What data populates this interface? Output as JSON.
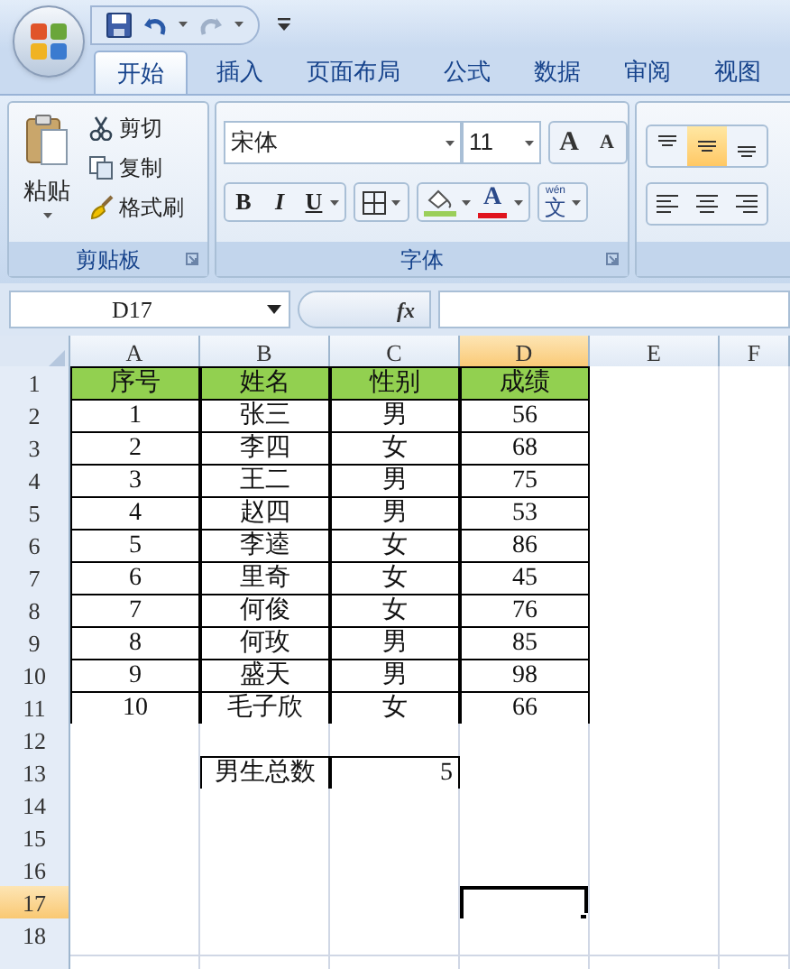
{
  "quick_access_toolbar": {
    "redo_disabled": true
  },
  "tabs": [
    {
      "label": "开始",
      "selected": true
    },
    {
      "label": "插入",
      "selected": false
    },
    {
      "label": "页面布局",
      "selected": false
    },
    {
      "label": "公式",
      "selected": false
    },
    {
      "label": "数据",
      "selected": false
    },
    {
      "label": "审阅",
      "selected": false
    },
    {
      "label": "视图",
      "selected": false
    }
  ],
  "ribbon": {
    "clipboard": {
      "paste": "粘贴",
      "cut": "剪切",
      "copy": "复制",
      "format_painter": "格式刷",
      "label": "剪贴板"
    },
    "font": {
      "font_name": "宋体",
      "font_size": "11",
      "grow_font": "A",
      "shrink_font": "A",
      "bold": "B",
      "italic": "I",
      "underline": "U",
      "font_color": "A",
      "phonetic_pinyin": "wén",
      "phonetic_char": "文",
      "label": "字体"
    },
    "alignment": {
      "vertical_align": [
        {
          "selected": false
        },
        {
          "selected": true
        },
        {
          "selected": false
        }
      ],
      "horizontal_align": [
        {
          "selected": false
        },
        {
          "selected": false
        },
        {
          "selected": false
        }
      ]
    }
  },
  "formula_bar": {
    "name_box": "D17",
    "function_button": "fx"
  },
  "columns": [
    {
      "label": "A",
      "selected": false
    },
    {
      "label": "B",
      "selected": false
    },
    {
      "label": "C",
      "selected": false
    },
    {
      "label": "D",
      "selected": true
    },
    {
      "label": "E",
      "selected": false
    },
    {
      "label": "F",
      "selected": false
    }
  ],
  "rows": [
    {
      "header": "1",
      "selected": false,
      "kind": "header",
      "cells": [
        {
          "text": "序号",
          "bordered": true,
          "selected": false
        },
        {
          "text": "姓名",
          "bordered": true,
          "selected": false
        },
        {
          "text": "性别",
          "bordered": true,
          "selected": false
        },
        {
          "text": "成绩",
          "bordered": true,
          "selected": false
        },
        {
          "bordered": false,
          "selected": false
        },
        {
          "bordered": false,
          "selected": false
        }
      ]
    },
    {
      "header": "2",
      "selected": false,
      "kind": "data",
      "cells": [
        {
          "text": "1",
          "bordered": true,
          "selected": false
        },
        {
          "text": "张三",
          "bordered": true,
          "selected": false
        },
        {
          "text": "男",
          "bordered": true,
          "selected": false
        },
        {
          "text": "56",
          "bordered": true,
          "selected": false
        },
        {
          "bordered": false,
          "selected": false
        },
        {
          "bordered": false,
          "selected": false
        }
      ]
    },
    {
      "header": "3",
      "selected": false,
      "kind": "data",
      "cells": [
        {
          "text": "2",
          "bordered": true,
          "selected": false
        },
        {
          "text": "李四",
          "bordered": true,
          "selected": false
        },
        {
          "text": "女",
          "bordered": true,
          "selected": false
        },
        {
          "text": "68",
          "bordered": true,
          "selected": false
        },
        {
          "bordered": false,
          "selected": false
        },
        {
          "bordered": false,
          "selected": false
        }
      ]
    },
    {
      "header": "4",
      "selected": false,
      "kind": "data",
      "cells": [
        {
          "text": "3",
          "bordered": true,
          "selected": false
        },
        {
          "text": "王二",
          "bordered": true,
          "selected": false
        },
        {
          "text": "男",
          "bordered": true,
          "selected": false
        },
        {
          "text": "75",
          "bordered": true,
          "selected": false
        },
        {
          "bordered": false,
          "selected": false
        },
        {
          "bordered": false,
          "selected": false
        }
      ]
    },
    {
      "header": "5",
      "selected": false,
      "kind": "data",
      "cells": [
        {
          "text": "4",
          "bordered": true,
          "selected": false
        },
        {
          "text": "赵四",
          "bordered": true,
          "selected": false
        },
        {
          "text": "男",
          "bordered": true,
          "selected": false
        },
        {
          "text": "53",
          "bordered": true,
          "selected": false
        },
        {
          "bordered": false,
          "selected": false
        },
        {
          "bordered": false,
          "selected": false
        }
      ]
    },
    {
      "header": "6",
      "selected": false,
      "kind": "data",
      "cells": [
        {
          "text": "5",
          "bordered": true,
          "selected": false
        },
        {
          "text": "李逵",
          "bordered": true,
          "selected": false
        },
        {
          "text": "女",
          "bordered": true,
          "selected": false
        },
        {
          "text": "86",
          "bordered": true,
          "selected": false
        },
        {
          "bordered": false,
          "selected": false
        },
        {
          "bordered": false,
          "selected": false
        }
      ]
    },
    {
      "header": "7",
      "selected": false,
      "kind": "data",
      "cells": [
        {
          "text": "6",
          "bordered": true,
          "selected": false
        },
        {
          "text": "里奇",
          "bordered": true,
          "selected": false
        },
        {
          "text": "女",
          "bordered": true,
          "selected": false
        },
        {
          "text": "45",
          "bordered": true,
          "selected": false
        },
        {
          "bordered": false,
          "selected": false
        },
        {
          "bordered": false,
          "selected": false
        }
      ]
    },
    {
      "header": "8",
      "selected": false,
      "kind": "data",
      "cells": [
        {
          "text": "7",
          "bordered": true,
          "selected": false
        },
        {
          "text": "何俊",
          "bordered": true,
          "selected": false
        },
        {
          "text": "女",
          "bordered": true,
          "selected": false
        },
        {
          "text": "76",
          "bordered": true,
          "selected": false
        },
        {
          "bordered": false,
          "selected": false
        },
        {
          "bordered": false,
          "selected": false
        }
      ]
    },
    {
      "header": "9",
      "selected": false,
      "kind": "data",
      "cells": [
        {
          "text": "8",
          "bordered": true,
          "selected": false
        },
        {
          "text": "何玫",
          "bordered": true,
          "selected": false
        },
        {
          "text": "男",
          "bordered": true,
          "selected": false
        },
        {
          "text": "85",
          "bordered": true,
          "selected": false
        },
        {
          "bordered": false,
          "selected": false
        },
        {
          "bordered": false,
          "selected": false
        }
      ]
    },
    {
      "header": "10",
      "selected": false,
      "kind": "data",
      "cells": [
        {
          "text": "9",
          "bordered": true,
          "selected": false
        },
        {
          "text": "盛天",
          "bordered": true,
          "selected": false
        },
        {
          "text": "男",
          "bordered": true,
          "selected": false
        },
        {
          "text": "98",
          "bordered": true,
          "selected": false
        },
        {
          "bordered": false,
          "selected": false
        },
        {
          "bordered": false,
          "selected": false
        }
      ]
    },
    {
      "header": "11",
      "selected": false,
      "kind": "data",
      "cells": [
        {
          "text": "10",
          "bordered": true,
          "selected": false
        },
        {
          "text": "毛子欣",
          "bordered": true,
          "selected": false
        },
        {
          "text": "女",
          "bordered": true,
          "selected": false
        },
        {
          "text": "66",
          "bordered": true,
          "selected": false
        },
        {
          "bordered": false,
          "selected": false
        },
        {
          "bordered": false,
          "selected": false
        }
      ]
    },
    {
      "header": "12",
      "selected": false,
      "kind": "blank",
      "cells": [
        {
          "bordered": false,
          "selected": false
        },
        {
          "bordered": false,
          "selected": false
        },
        {
          "bordered": false,
          "selected": false
        },
        {
          "bordered": false,
          "selected": false
        },
        {
          "bordered": false,
          "selected": false
        },
        {
          "bordered": false,
          "selected": false
        }
      ]
    },
    {
      "header": "13",
      "selected": false,
      "kind": "data",
      "cells": [
        {
          "bordered": false,
          "selected": false
        },
        {
          "text": "男生总数",
          "bordered": true,
          "selected": false
        },
        {
          "text": "5",
          "bordered": true,
          "selected": false,
          "right_aligned": true
        },
        {
          "bordered": false,
          "selected": false
        },
        {
          "bordered": false,
          "selected": false
        },
        {
          "bordered": false,
          "selected": false
        }
      ]
    },
    {
      "header": "14",
      "selected": false,
      "kind": "blank",
      "cells": [
        {
          "bordered": false,
          "selected": false
        },
        {
          "bordered": false,
          "selected": false
        },
        {
          "bordered": false,
          "selected": false
        },
        {
          "bordered": false,
          "selected": false
        },
        {
          "bordered": false,
          "selected": false
        },
        {
          "bordered": false,
          "selected": false
        }
      ]
    },
    {
      "header": "15",
      "selected": false,
      "kind": "blank",
      "cells": [
        {
          "bordered": false,
          "selected": false
        },
        {
          "bordered": false,
          "selected": false
        },
        {
          "bordered": false,
          "selected": false
        },
        {
          "bordered": false,
          "selected": false
        },
        {
          "bordered": false,
          "selected": false
        },
        {
          "bordered": false,
          "selected": false
        }
      ]
    },
    {
      "header": "16",
      "selected": false,
      "kind": "blank",
      "cells": [
        {
          "bordered": false,
          "selected": false
        },
        {
          "bordered": false,
          "selected": false
        },
        {
          "bordered": false,
          "selected": false
        },
        {
          "bordered": false,
          "selected": false
        },
        {
          "bordered": false,
          "selected": false
        },
        {
          "bordered": false,
          "selected": false
        }
      ]
    },
    {
      "header": "17",
      "selected": true,
      "kind": "blank",
      "cells": [
        {
          "bordered": false,
          "selected": false
        },
        {
          "bordered": false,
          "selected": false
        },
        {
          "bordered": false,
          "selected": false
        },
        {
          "bordered": false,
          "selected": true
        },
        {
          "bordered": false,
          "selected": false
        },
        {
          "bordered": false,
          "selected": false
        }
      ]
    },
    {
      "header": "18",
      "selected": false,
      "kind": "blank",
      "cells": [
        {
          "bordered": false,
          "selected": false
        },
        {
          "bordered": false,
          "selected": false
        },
        {
          "bordered": false,
          "selected": false
        },
        {
          "bordered": false,
          "selected": false
        },
        {
          "bordered": false,
          "selected": false
        },
        {
          "bordered": false,
          "selected": false
        }
      ]
    }
  ]
}
